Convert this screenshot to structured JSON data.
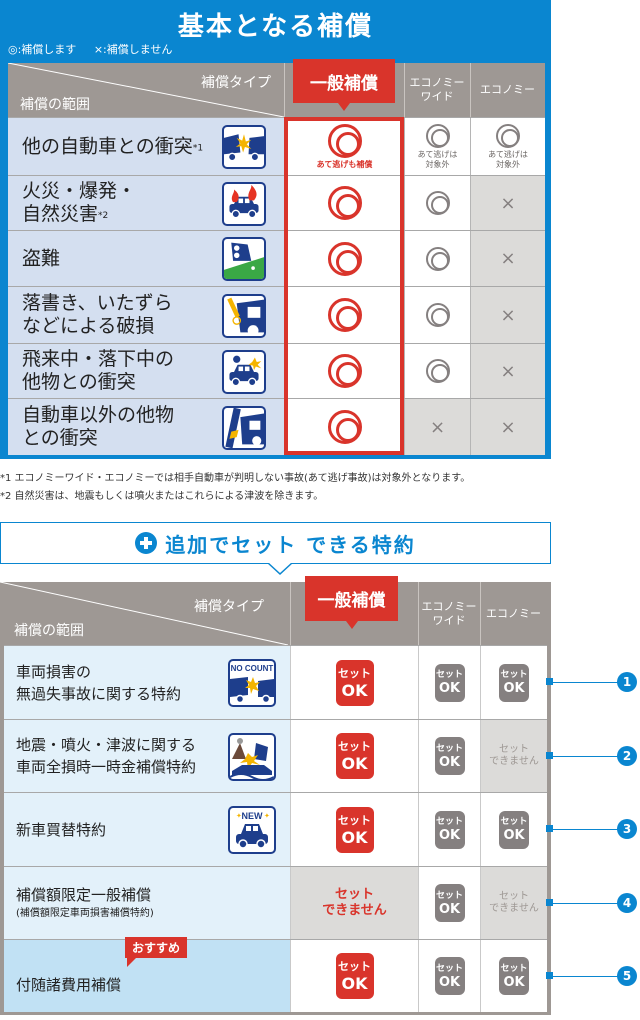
{
  "basic": {
    "title": "基本となる補償",
    "legend": [
      "◎:補償します",
      "×:補償しません"
    ],
    "header": {
      "type_label": "補償タイプ",
      "range_label": "補償の範囲",
      "columns": [
        {
          "label": "一般補償",
          "highlight": true
        },
        {
          "label": "エコノミー\nワイド",
          "line1": "エコノミー",
          "line2": "ワイド"
        },
        {
          "label": "エコノミー"
        }
      ]
    },
    "rows": [
      {
        "line1": "他の自動車との衝突",
        "line2": "",
        "note": "*1",
        "icon": "car-collision-icon",
        "general": {
          "mark": "double-circle",
          "sub": "あて逃げも補償"
        },
        "wide": {
          "mark": "double-circle",
          "sub": "あて逃げは\n対象外",
          "sub1": "あて逃げは",
          "sub2": "対象外"
        },
        "economy": {
          "mark": "double-circle",
          "sub": "あて逃げは\n対象外",
          "sub1": "あて逃げは",
          "sub2": "対象外"
        }
      },
      {
        "line1": "火災・爆発・",
        "line2": "自然災害",
        "note": "*2",
        "icon": "car-fire-icon",
        "general": {
          "mark": "double-circle"
        },
        "wide": {
          "mark": "double-circle"
        },
        "economy": {
          "mark": "cross"
        }
      },
      {
        "line1": "盗難",
        "line2": "",
        "note": "",
        "icon": "car-theft-icon",
        "general": {
          "mark": "double-circle"
        },
        "wide": {
          "mark": "double-circle"
        },
        "economy": {
          "mark": "cross"
        }
      },
      {
        "line1": "落書き、いたずら",
        "line2": "などによる破損",
        "note": "",
        "icon": "car-vandalism-icon",
        "general": {
          "mark": "double-circle"
        },
        "wide": {
          "mark": "double-circle"
        },
        "economy": {
          "mark": "cross"
        }
      },
      {
        "line1": "飛来中・落下中の",
        "line2": "他物との衝突",
        "note": "",
        "icon": "falling-object-icon",
        "general": {
          "mark": "double-circle"
        },
        "wide": {
          "mark": "double-circle"
        },
        "economy": {
          "mark": "cross"
        }
      },
      {
        "line1": "自動車以外の他物",
        "line2": "との衝突",
        "note": "",
        "icon": "pole-collision-icon",
        "general": {
          "mark": "double-circle"
        },
        "wide": {
          "mark": "cross"
        },
        "economy": {
          "mark": "cross"
        }
      }
    ],
    "marks": {
      "double_circle": "◎",
      "cross": "×"
    }
  },
  "footnotes": [
    "*1 エコノミーワイド・エコノミーでは相手自動車が判明しない事故(あて逃げ事故)は対象外となります。",
    "*2 自然災害は、地震もしくは噴火またはこれらによる津波を除きます。"
  ],
  "addon": {
    "banner": "追加でセット できる特約",
    "header": {
      "type_label": "補償タイプ",
      "range_label": "補償の範囲",
      "columns": [
        {
          "label": "一般補償",
          "highlight": true
        },
        {
          "line1": "エコノミー",
          "line2": "ワイド"
        },
        {
          "label": "エコノミー"
        }
      ]
    },
    "set_ok": {
      "line1": "セット",
      "line2": "OK"
    },
    "cannot": {
      "line1": "セット",
      "line2": "できません"
    },
    "recommend_badge": "おすすめ",
    "rows": [
      {
        "num": "1",
        "line1": "車両損害の",
        "line2": "無過失事故に関する特約",
        "small": "",
        "icon": "no-count-icon",
        "icon_text": "NO COUNT",
        "general": "ok",
        "wide": "ok",
        "economy": "ok"
      },
      {
        "num": "2",
        "line1": "地震・噴火・津波に関する",
        "line2": "車両全損時一時金補償特約",
        "small": "",
        "icon": "earthquake-icon",
        "general": "ok",
        "wide": "ok",
        "economy": "cannot"
      },
      {
        "num": "3",
        "line1": "新車買替特約",
        "line2": "",
        "small": "",
        "icon": "new-car-icon",
        "icon_text": "NEW",
        "general": "ok",
        "wide": "ok",
        "economy": "ok"
      },
      {
        "num": "4",
        "line1": "補償額限定一般補償",
        "line2": "",
        "small": "(補償額限定車両損害補償特約)",
        "icon": "",
        "general": "cannot",
        "wide": "ok",
        "economy": "cannot"
      },
      {
        "num": "5",
        "line1": "付随諸費用補償",
        "line2": "",
        "small": "",
        "icon": "",
        "recommended": true,
        "general": "ok",
        "wide": "ok",
        "economy": "ok"
      }
    ]
  },
  "colors": {
    "brand_blue": "#0a86d0",
    "accent_red": "#d9342b",
    "header_gray": "#9e9894",
    "mark_gray": "#858080"
  }
}
